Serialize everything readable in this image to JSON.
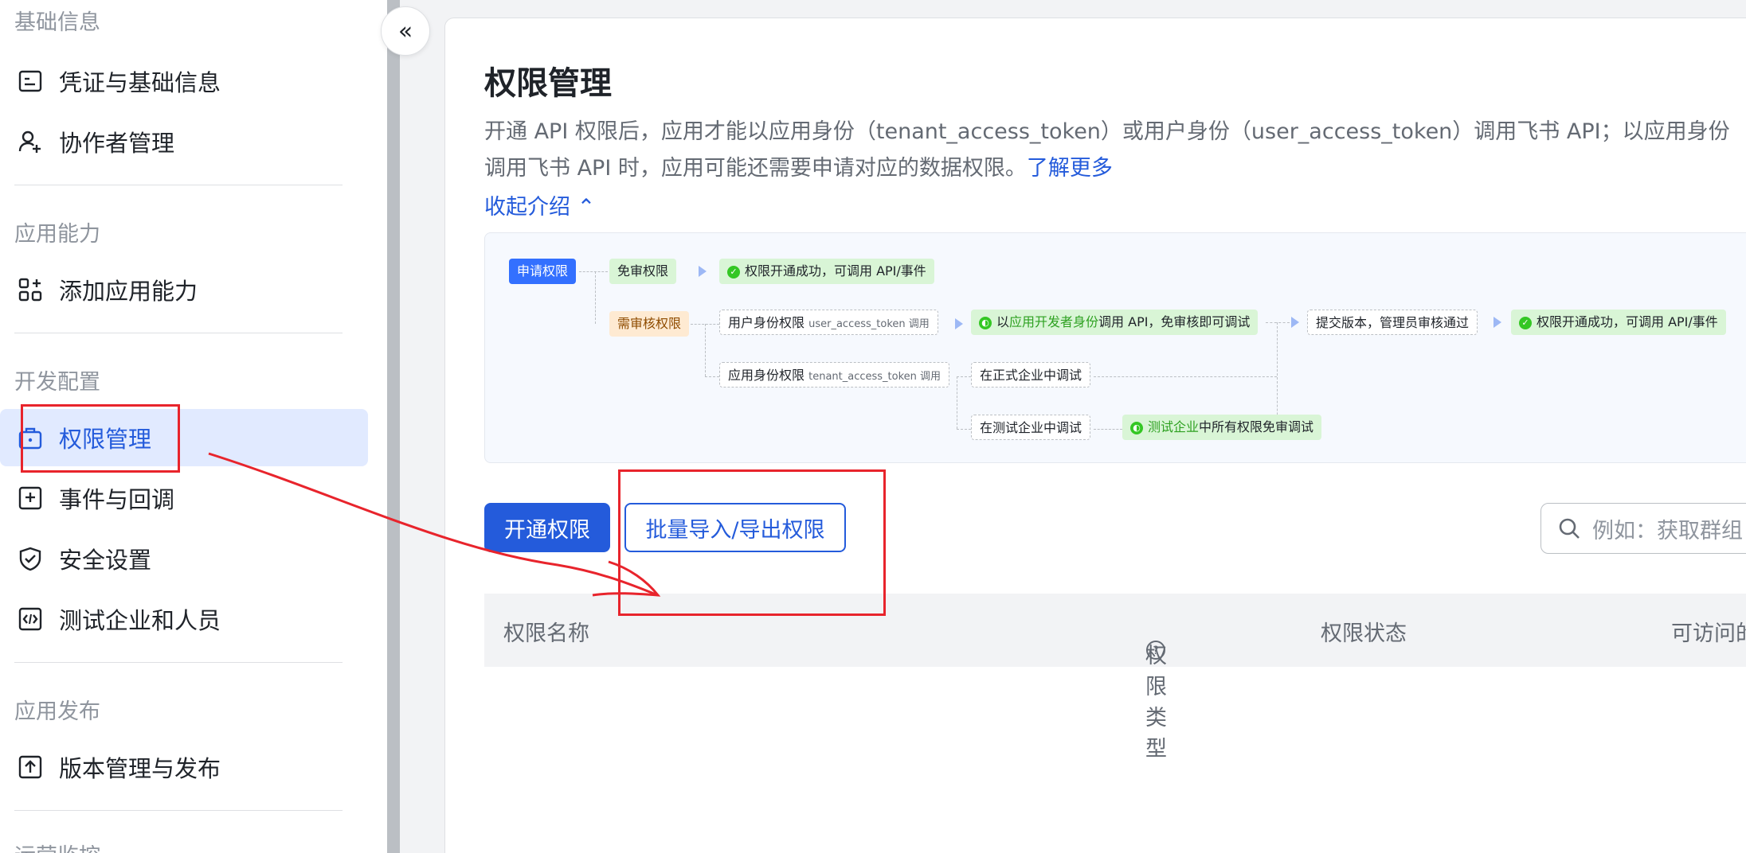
{
  "sidebar": {
    "sections": [
      {
        "title": "基础信息"
      },
      {
        "title": "应用能力"
      },
      {
        "title": "开发配置"
      },
      {
        "title": "应用发布"
      },
      {
        "title": "运营监控"
      }
    ],
    "items": [
      {
        "label": "凭证与基础信息",
        "icon": "credential-icon"
      },
      {
        "label": "协作者管理",
        "icon": "add-user-icon"
      },
      {
        "label": "添加应用能力",
        "icon": "add-app-icon"
      },
      {
        "label": "权限管理",
        "icon": "permission-icon"
      },
      {
        "label": "事件与回调",
        "icon": "event-icon"
      },
      {
        "label": "安全设置",
        "icon": "shield-icon"
      },
      {
        "label": "测试企业和人员",
        "icon": "test-code-icon"
      },
      {
        "label": "版本管理与发布",
        "icon": "publish-icon"
      }
    ]
  },
  "collapse_button": "«",
  "main": {
    "title": "权限管理",
    "description_line1": "开通 API 权限后，应用才能以应用身份（tenant_access_token）或用户身份（user_access_token）调用飞书 API；以应用身份",
    "description_line2": "调用飞书 API 时，应用可能还需要申请对应的数据权限。",
    "learn_more": "了解更多",
    "collapse_intro": "收起介绍 ⌃",
    "flow": {
      "apply": "申请权限",
      "free_review": "免审权限",
      "success1": "权限开通成功，可调用 API/事件",
      "need_review": "需审核权限",
      "user_perm": "用户身份权限",
      "user_perm_sub": "user_access_token 调用",
      "dev_identity_a": "以",
      "dev_identity_b": "应用开发者身份",
      "dev_identity_c": "调用 API，免审核即可调试",
      "submit": "提交版本，管理员审核通过",
      "success2": "权限开通成功，可调用 API/事件",
      "tenant_perm": "应用身份权限",
      "tenant_perm_sub": "tenant_access_token 调用",
      "formal_debug": "在正式企业中调试",
      "test_debug": "在测试企业中调试",
      "test_free_a": "测试企业",
      "test_free_b": "中所有权限免审调试"
    },
    "buttons": {
      "open_permission": "开通权限",
      "batch_import_export": "批量导入/导出权限"
    },
    "search": {
      "placeholder": "例如：获取群组"
    },
    "table": {
      "columns": [
        "权限名称",
        "权限类型",
        "权限状态",
        "可访问的"
      ]
    }
  },
  "colors": {
    "primary": "#245bdb",
    "annotation": "#e8242c",
    "active_bg": "#e1eaff"
  }
}
